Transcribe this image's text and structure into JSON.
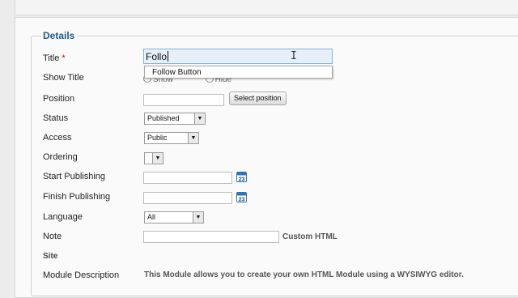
{
  "details": {
    "legend": "Details",
    "title": {
      "label": "Title",
      "required_mark": "*",
      "value": "Follo",
      "suggestion": "Follow Button"
    },
    "show_title": {
      "label": "Show Title",
      "option_show": "Show",
      "option_hide": "Hide"
    },
    "position": {
      "label": "Position",
      "value": "",
      "button": "Select position"
    },
    "status": {
      "label": "Status",
      "value": "Published"
    },
    "access": {
      "label": "Access",
      "value": "Public"
    },
    "ordering": {
      "label": "Ordering",
      "value": ""
    },
    "start_publishing": {
      "label": "Start Publishing",
      "value": "",
      "calendar_day": "23"
    },
    "finish_publishing": {
      "label": "Finish Publishing",
      "value": "",
      "calendar_day": "23"
    },
    "language": {
      "label": "Language",
      "value": "All"
    },
    "note": {
      "label": "Note",
      "value": "",
      "after_text": "Custom HTML"
    },
    "site": {
      "label": "Site"
    },
    "module_description": {
      "label": "Module Description",
      "text": "This Module allows you to create your own HTML Module using a WYSIWYG editor."
    }
  },
  "colors": {
    "legend": "#1f5b86",
    "calendar": "#2f74b8",
    "title_focus_bg": "#e6f0fb"
  }
}
